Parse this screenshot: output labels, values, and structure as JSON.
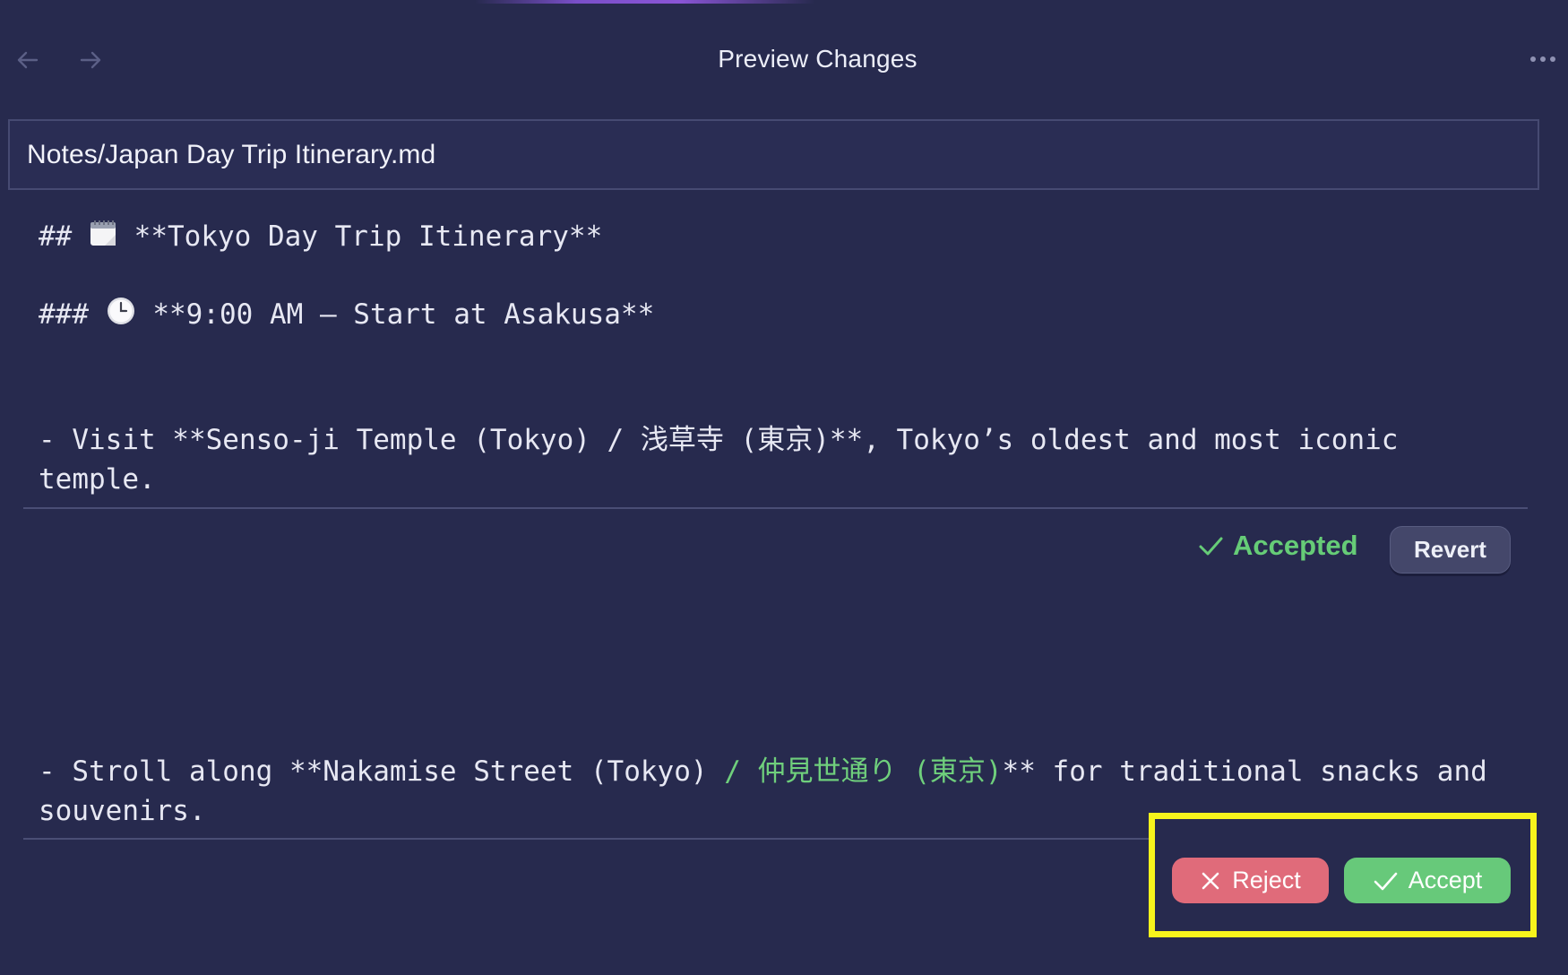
{
  "window": {
    "title": "Preview Changes"
  },
  "file": {
    "path": "Notes/Japan Day Trip Itinerary.md"
  },
  "content": {
    "heading2_prefix": "## ",
    "heading2_text": " **Tokyo Day Trip Itinerary**",
    "heading3_prefix": "### ",
    "heading3_text": " **9:00 AM – Start at Asakusa**",
    "line1_a": "- Visit **Senso-ji Temple (Tokyo) / 浅草寺 (東京)**, Tokyo’s oldest and most iconic",
    "line1_b": "temple.",
    "line2_a_plain": "- Stroll along **Nakamise Street (Tokyo) ",
    "line2_a_green": "/ 仲見世通り (東京)",
    "line2_a_rest": "** for traditional snacks and",
    "line2_b": "souvenirs."
  },
  "change1": {
    "status": "Accepted",
    "revert_label": "Revert"
  },
  "change2": {
    "reject_label": "Reject",
    "accept_label": "Accept"
  },
  "icons": {
    "back": "arrow-left-icon",
    "forward": "arrow-right-icon",
    "more": "ellipsis-icon",
    "calendar": "calendar-emoji-icon",
    "clock": "clock-emoji-icon",
    "check": "check-icon",
    "close": "x-icon"
  },
  "colors": {
    "background": "#272a4e",
    "accepted_green": "#66cc77",
    "reject_red": "#e06b7a",
    "accept_green": "#67c97a",
    "highlight_yellow": "#f7f41c"
  }
}
